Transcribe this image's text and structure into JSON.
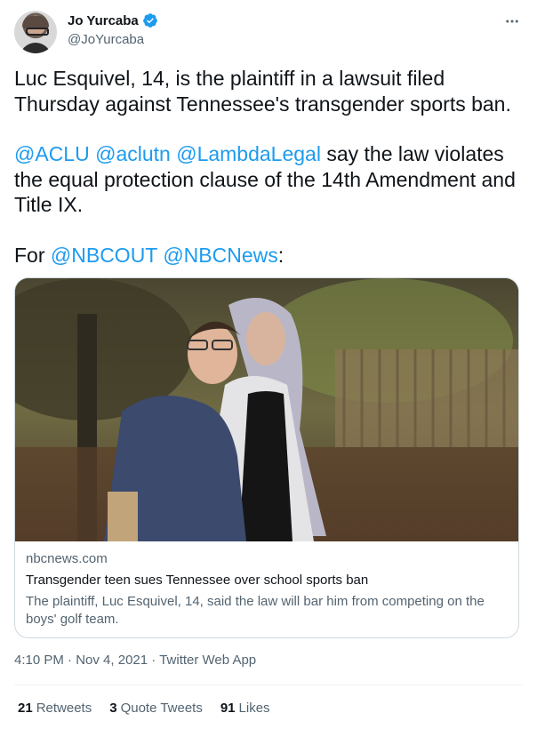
{
  "author": {
    "name": "Jo Yurcaba",
    "handle": "@JoYurcaba",
    "verified_icon": "verified-badge-icon",
    "more_icon": "more-options-icon"
  },
  "tweet": {
    "line1": "Luc Esquivel, 14, is the plaintiff in a lawsuit filed Thursday against Tennessee's transgender sports ban.",
    "mention1": "@ACLU",
    "mention2": "@aclutn",
    "mention3": "@LambdaLegal",
    "line2_rest": "say the law violates the equal protection clause of the 14th Amendment and Title IX.",
    "for_prefix": "For",
    "mention4": "@NBCOUT",
    "mention5": "@NBCNews",
    "for_suffix": ":"
  },
  "card": {
    "domain": "nbcnews.com",
    "title": "Transgender teen sues Tennessee over school sports ban",
    "description": "The plaintiff, Luc Esquivel, 14, said the law will bar him from competing on the boys' golf team."
  },
  "meta": {
    "time": "4:10 PM",
    "date": "Nov 4, 2021",
    "client": "Twitter Web App",
    "sep": "·"
  },
  "stats": {
    "retweets_count": "21",
    "retweets_label": "Retweets",
    "quotes_count": "3",
    "quotes_label": "Quote Tweets",
    "likes_count": "91",
    "likes_label": "Likes"
  },
  "colors": {
    "link": "#1d9bf0",
    "secondary": "#536471",
    "primary": "#0f1419",
    "border": "#cfd9de"
  }
}
